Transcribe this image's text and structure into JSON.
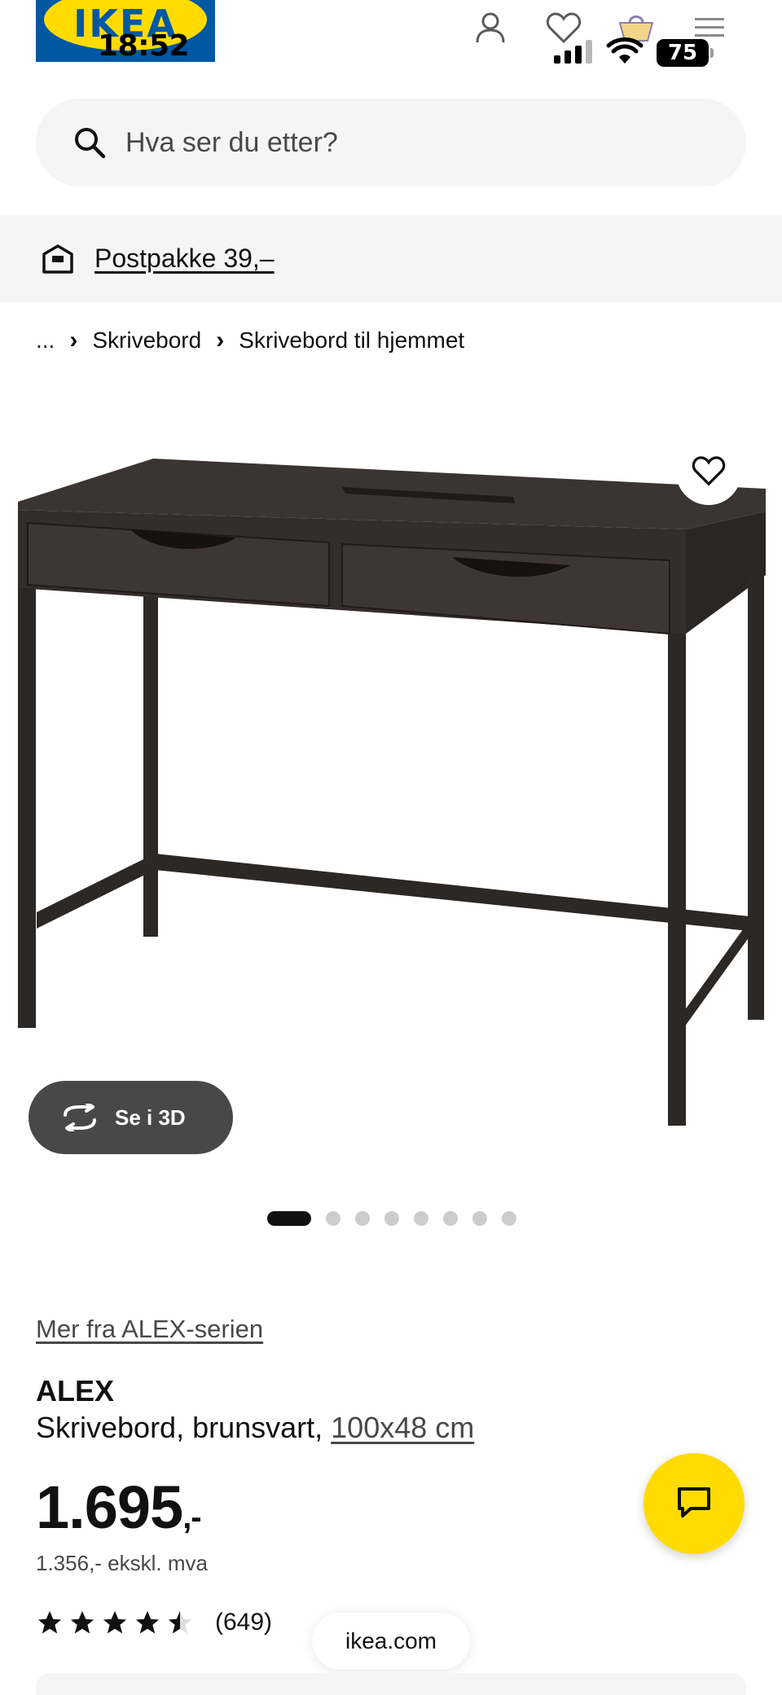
{
  "status_bar": {
    "time": "18:52",
    "battery": "75"
  },
  "header": {
    "logo_text": "IKEA",
    "icons": [
      "user-icon",
      "heart-icon",
      "basket-icon",
      "menu-icon"
    ]
  },
  "search": {
    "placeholder": "Hva ser du etter?"
  },
  "delivery": {
    "label": "Postpakke 39,–"
  },
  "breadcrumb": {
    "items": [
      "...",
      "Skrivebord",
      "Skrivebord til hjemmet"
    ]
  },
  "gallery": {
    "view_3d_label": "Se i 3D",
    "dot_count": 8,
    "active_dot": 1
  },
  "product": {
    "series_link": "Mer fra ALEX-serien",
    "name": "ALEX",
    "description": "Skrivebord, brunsvart, ",
    "size_link": "100x48 cm",
    "price_main": "1.695",
    "price_suffix": ",-",
    "price_ex_vat": "1.356,- ekskl. mva",
    "rating_value": 4.5,
    "rating_max": 5,
    "review_count": "(649)"
  },
  "browser": {
    "url": "ikea.com"
  },
  "colors": {
    "brand_blue": "#0058a3",
    "brand_yellow": "#ffdb00",
    "surface": "#f5f5f5",
    "text": "#111111",
    "dark_button": "#484848"
  }
}
